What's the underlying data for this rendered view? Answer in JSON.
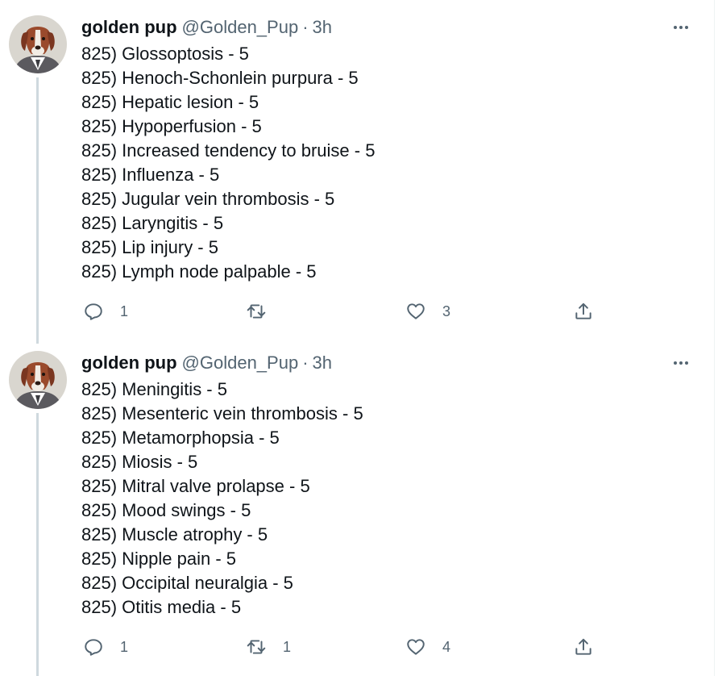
{
  "tweets": [
    {
      "author": {
        "name": "golden pup",
        "handle": "@Golden_Pup",
        "separator": "·",
        "time": "3h"
      },
      "lines": [
        "825) Glossoptosis - 5",
        "825) Henoch-Schonlein purpura - 5",
        "825) Hepatic lesion - 5",
        "825) Hypoperfusion - 5",
        "825) Increased tendency to bruise - 5",
        "825) Influenza - 5",
        "825) Jugular vein thrombosis - 5",
        "825) Laryngitis - 5",
        "825) Lip injury - 5",
        "825) Lymph node palpable - 5"
      ],
      "actions": {
        "reply_count": "1",
        "retweet_count": "",
        "like_count": "3"
      }
    },
    {
      "author": {
        "name": "golden pup",
        "handle": "@Golden_Pup",
        "separator": "·",
        "time": "3h"
      },
      "lines": [
        "825) Meningitis - 5",
        "825) Mesenteric vein thrombosis - 5",
        "825) Metamorphopsia - 5",
        "825) Miosis - 5",
        "825) Mitral valve prolapse - 5",
        "825) Mood swings - 5",
        "825) Muscle atrophy - 5",
        "825) Nipple pain - 5",
        "825) Occipital neuralgia - 5",
        "825) Otitis media - 5"
      ],
      "actions": {
        "reply_count": "1",
        "retweet_count": "1",
        "like_count": "4"
      }
    }
  ],
  "icons": {
    "reply": "reply-icon",
    "retweet": "retweet-icon",
    "like": "heart-icon",
    "share": "share-icon",
    "more": "more-options-icon"
  },
  "colors": {
    "text_primary": "#0f1419",
    "text_secondary": "#536471",
    "thread_line": "#cfd9de"
  }
}
